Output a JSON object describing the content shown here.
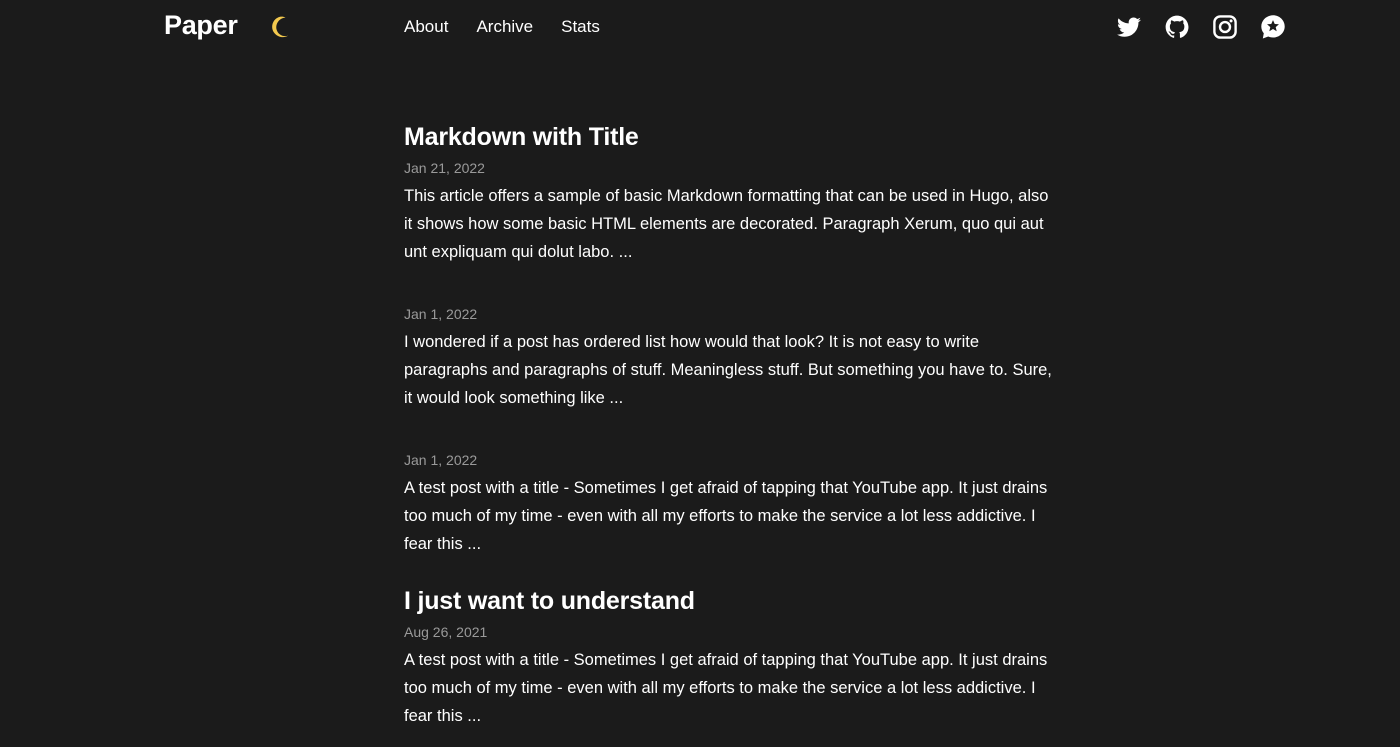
{
  "site": {
    "brand": "Paper",
    "theme_toggle_icon": "moon-icon"
  },
  "nav": [
    {
      "label": "About"
    },
    {
      "label": "Archive"
    },
    {
      "label": "Stats"
    }
  ],
  "social": [
    {
      "icon": "twitter-icon"
    },
    {
      "icon": "github-icon"
    },
    {
      "icon": "instagram-icon"
    },
    {
      "icon": "star-chat-icon"
    }
  ],
  "posts": [
    {
      "title": "Markdown with Title",
      "date": "Jan 21, 2022",
      "summary": "This article offers a sample of basic Markdown formatting that can be used in Hugo, also it shows how some basic HTML elements are decorated. Paragraph Xerum, quo qui aut unt expliquam qui dolut labo. ..."
    },
    {
      "title": "",
      "date": "Jan 1, 2022",
      "summary": "I wondered if a post has ordered list how would that look? It is not easy to write paragraphs and paragraphs of stuff. Meaningless stuff. But something you have to. Sure, it would look something like ..."
    },
    {
      "title": "",
      "date": "Jan 1, 2022",
      "summary": "A test post with a title - Sometimes I get afraid of tapping that YouTube app. It just drains too much of my time - even with all my efforts to make the service a lot less addictive. I fear this ..."
    },
    {
      "title": "I just want to understand",
      "date": "Aug 26, 2021",
      "summary": "A test post with a title - Sometimes I get afraid of tapping that YouTube app. It just drains too much of my time - even with all my efforts to make the service a lot less addictive. I fear this ..."
    }
  ],
  "colors": {
    "background": "#1b1b1b",
    "text": "#ffffff",
    "muted": "#9a9a9a",
    "moon": "#f3c94e"
  }
}
